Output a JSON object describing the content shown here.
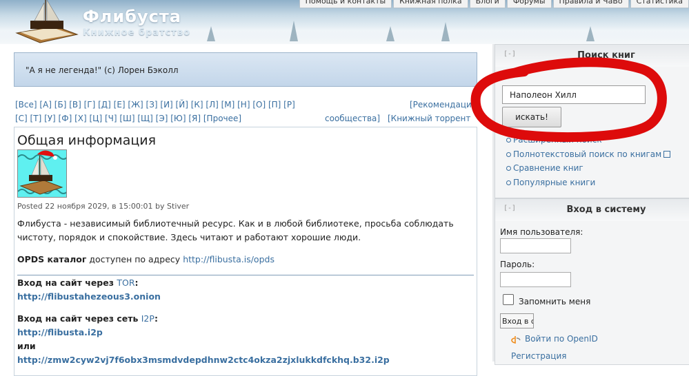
{
  "site": {
    "title": "Флибуста",
    "slogan": "Книжное братство"
  },
  "topnav": [
    "Помощь и контакты",
    "Книжная полка",
    "Блоги",
    "Форумы",
    "Правила и ЧаВо",
    "Статистика"
  ],
  "quote": "\"А я не легенда!\" (c) Лорен Бэколл",
  "alphabet": {
    "row1": "[Все] [А] [Б] [В] [Г] [Д] [Е] [Ж] [З] [И] [Й] [К] [Л] [М] [Н] [О] [П] [Р]",
    "row2": "[С] [Т] [У] [Ф] [Х] [Ц] [Ч] [Ш] [Щ] [Э] [Ю] [Я] [Прочее]",
    "recommend": "[Рекомендаци",
    "community": "сообщества]",
    "torrent": "[Книжный торрент"
  },
  "content": {
    "title": "Общая информация",
    "posted": "Posted 22 ноября 2029, в 15:00:01 by Stiver",
    "intro_line1": "Флибуста - независимый библиотечный ресурс. Как и в любой библиотеке, просьба соблюдать",
    "intro_line2": "чистоту, порядок и спокойствие. Здесь читают и работают хорошие люди.",
    "opds_label": "OPDS каталог",
    "opds_text": " доступен по адресу ",
    "opds_url": "http://flibusta.is/opds",
    "tor_label": "Вход на сайт через ",
    "tor_link": "TOR",
    "tor_url": "http://flibustahezeous3.onion",
    "i2p_label": "Вход на сайт через сеть ",
    "i2p_link": "I2P",
    "i2p_url": "http://flibusta.i2p",
    "or": "или",
    "b32_url": "http://zmw2cyw2vj7f6obx3msmdvdepdhnw2ctc4okza2zjxlukkdfckhq.b32.i2p"
  },
  "search": {
    "collapse": "[-]",
    "title": "Поиск книг",
    "value": "Наполеон Хилл",
    "button": "искать!",
    "links": [
      "Расширенный поиск",
      "Полнотекстовый поиск по книгам",
      "Сравнение книг",
      "Популярные книги"
    ]
  },
  "login": {
    "collapse": "[-]",
    "title": "Вход в систему",
    "username_label": "Имя пользователя:",
    "password_label": "Пароль:",
    "remember": "Запомнить меня",
    "button": "Вход в с",
    "openid": "Войти по OpenID",
    "register": "Регистрация"
  },
  "colors": {
    "annotation": "#dd0b0b",
    "link": "#3a6fa0"
  }
}
